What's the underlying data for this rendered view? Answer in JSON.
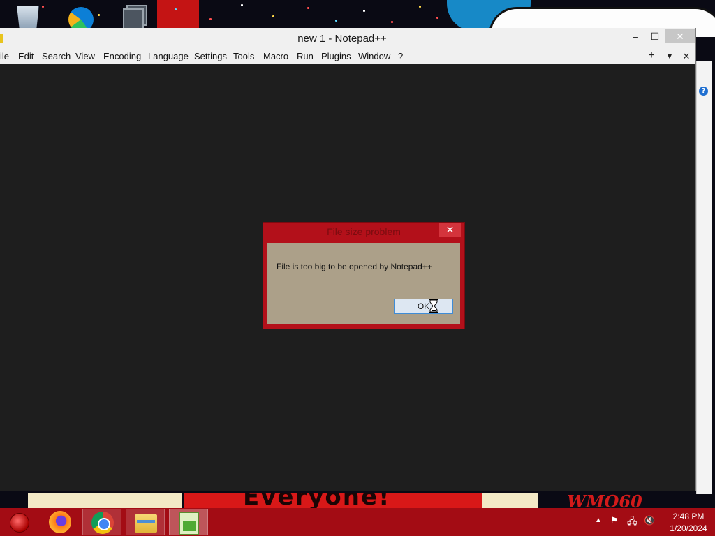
{
  "window": {
    "title": "new 1 - Notepad++",
    "minimize_label": "–",
    "maximize_label": "☐",
    "close_label": "✕"
  },
  "menu": [
    "ile",
    "Edit",
    "Search",
    "View",
    "Encoding",
    "Language",
    "Settings",
    "Tools",
    "Macro",
    "Run",
    "Plugins",
    "Window",
    "?"
  ],
  "tab_controls": {
    "new_tab": "+",
    "list_tabs": "▼",
    "close_tab": "✕"
  },
  "dialog": {
    "title": "File size problem",
    "close_label": "✕",
    "message": "File is too big to be opened by Notepad++",
    "ok_label": "OK"
  },
  "taskbar": {
    "apps": [
      {
        "name": "start",
        "icon": "start-orb-icon"
      },
      {
        "name": "Firefox",
        "icon": "firefox-icon"
      },
      {
        "name": "Google Chrome",
        "icon": "chrome-icon"
      },
      {
        "name": "File Explorer",
        "icon": "folder-icon"
      },
      {
        "name": "Notepad++",
        "icon": "notepadpp-icon",
        "active": true
      }
    ],
    "tray": {
      "chevron": "▲",
      "flag": "⚑",
      "network": "🖧",
      "volume": "🔇"
    },
    "clock": {
      "time": "2:48 PM",
      "date": "1/20/2024"
    }
  },
  "wallpaper": {
    "banner_text": "Everyone!",
    "corner_text": "WMO60",
    "accent_color": "#d81818"
  },
  "desktop_icons": [
    "recycle-bin-icon",
    "edge-icon",
    "task-view-icon"
  ]
}
